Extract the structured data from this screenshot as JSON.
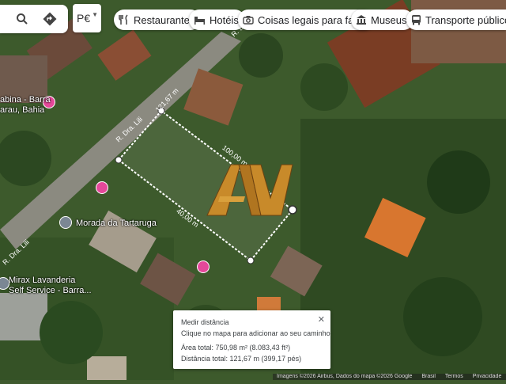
{
  "search": {
    "search_icon": "search-icon",
    "directions_icon": "directions-icon"
  },
  "language": {
    "value": "P€"
  },
  "chips": [
    {
      "label": "Restaurantes",
      "icon": "fork-knife-icon"
    },
    {
      "label": "Hotéis",
      "icon": "bed-icon"
    },
    {
      "label": "Coisas legais para fazer",
      "icon": "camera-icon"
    },
    {
      "label": "Museus",
      "icon": "museum-icon"
    },
    {
      "label": "Transporte público",
      "icon": "bus-icon"
    }
  ],
  "map": {
    "street_labels": [
      "R. Dra. Lili",
      "R. Dra. Lili",
      "R. Dra. Lili",
      "R. D"
    ],
    "places": [
      {
        "name": "Morada da Tartaruga"
      },
      {
        "name": "Mirax Lavanderia\nSelf Service - Barra..."
      },
      {
        "name": "abina - Barra\narau, Bahia"
      }
    ],
    "measurements": [
      "121,67 m",
      "100,00 m",
      "40,00 m"
    ],
    "logo_text": "AVM"
  },
  "measure_panel": {
    "title": "Medir distância",
    "hint": "Clique no mapa para adicionar ao seu caminho",
    "area": "Área total: 750,98 m² (8.083,43 ft²)",
    "distance": "Distância total: 121,67 m (399,17 pés)",
    "close": "✕"
  },
  "footer": {
    "attribution": "Imagens ©2026 Airbus, Dados do mapa ©2026 Google",
    "country": "Brasil",
    "terms": "Termos",
    "privacy": "Privacidade"
  },
  "colors": {
    "measure_line": "#ffffff",
    "logo_gold": "#c88a2a",
    "pin_pink": "#e5489a"
  }
}
